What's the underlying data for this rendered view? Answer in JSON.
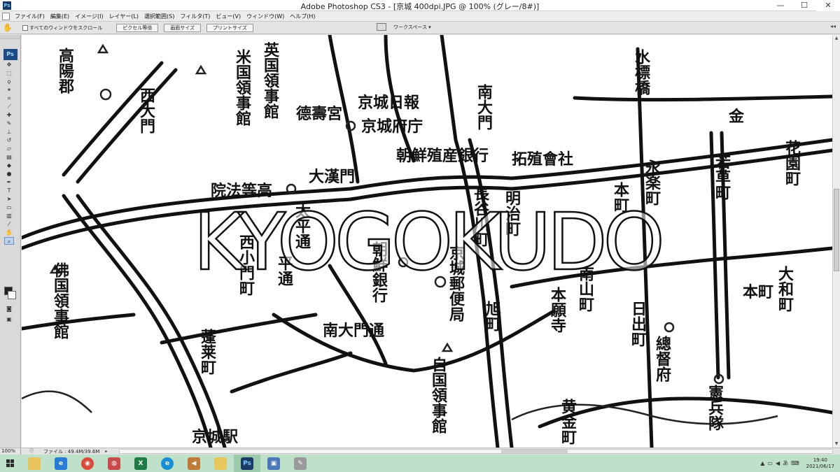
{
  "window": {
    "app_badge": "Ps",
    "title": "Adobe Photoshop CS3 - [京城 400dpi.JPG @ 100% (グレー/8#)]",
    "minimize": "—",
    "maximize": "☐",
    "close": "✕"
  },
  "menu": {
    "items": [
      "ファイル(F)",
      "編集(E)",
      "イメージ(I)",
      "レイヤー(L)",
      "選択範囲(S)",
      "フィルタ(T)",
      "ビュー(V)",
      "ウィンドウ(W)",
      "ヘルプ(H)"
    ]
  },
  "options": {
    "scroll_all_label": "すべてのウィンドウをスクロール",
    "btn_actual_pixels": "ピクセル等倍",
    "btn_fit_screen": "画面サイズ",
    "btn_print_size": "プリントサイズ",
    "workspace_label": "ワークスペース ▾"
  },
  "tools": {
    "logo": "Ps"
  },
  "document": {
    "watermark": "KYOGOKUDO",
    "map_labels": [
      "高陽郡",
      "英国領事館",
      "米国領事館",
      "京城日報",
      "京城府庁",
      "西大門",
      "德壽宮",
      "院法等高",
      "大漢門",
      "朝鮮殖産銀行",
      "拓殖會社",
      "明治町",
      "花園町",
      "若草町",
      "金",
      "水標橋",
      "南大門",
      "長谷川町",
      "本町",
      "永楽町",
      "朝鮮銀行",
      "京城郵便局",
      "南大門通",
      "佛国領事館",
      "本願寺",
      "南山町",
      "日出町",
      "總督府",
      "憲兵隊",
      "旭町",
      "大和町",
      "本町",
      "自国領事館",
      "京城駅",
      "蓬莱町",
      "平通",
      "西小門町",
      "太平通",
      "黄金町"
    ]
  },
  "status": {
    "zoom": "100%",
    "file_info": "ファイル : 49.4M/39.6M"
  },
  "taskbar": {
    "clock_time": "19:40",
    "clock_date": "2021/06/17"
  }
}
